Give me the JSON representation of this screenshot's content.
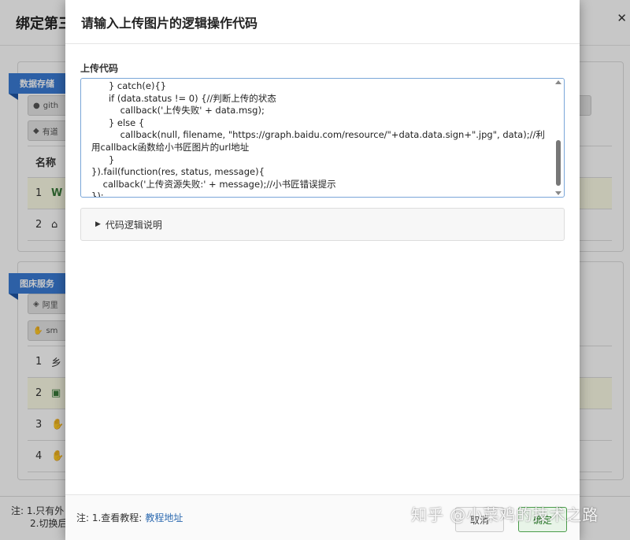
{
  "background": {
    "title": "绑定第三",
    "panel1": {
      "ribbon": "数据存储",
      "buttons": [
        "gith",
        "有道"
      ],
      "table_header": "名称",
      "rows": [
        {
          "num": "1",
          "glyph": "W"
        },
        {
          "num": "2",
          "glyph": "⌂"
        }
      ]
    },
    "panel2": {
      "ribbon": "图床服务",
      "buttons": [
        "阿里",
        "sm"
      ],
      "rows": [
        {
          "num": "1",
          "glyph": "乡"
        },
        {
          "num": "2",
          "glyph": "▣"
        },
        {
          "num": "3",
          "glyph": "✋"
        },
        {
          "num": "4",
          "glyph": "✋"
        }
      ]
    },
    "footer": {
      "line1": "注: 1.只有外",
      "line2": "2.切换后"
    },
    "corner_icon": "close-icon"
  },
  "modal": {
    "title": "请输入上传图片的逻辑操作代码",
    "field_label": "上传代码",
    "code": "      } catch(e){}\n      if (data.status != 0) {//判断上传的状态\n          callback('上传失败' + data.msg);\n      } else {\n          callback(null, filename, \"https://graph.baidu.com/resource/\"+data.data.sign+\".jpg\", data);//利用callback函数给小书匠图片的url地址\n      }\n}).fail(function(res, status, message){\n    callback('上传资源失败:' + message);//小书匠错误提示\n});",
    "details_label": "代码逻辑说明",
    "footer_note": "注: 1.查看教程:",
    "footer_link": "教程地址",
    "cancel_label": "取消",
    "ok_label": "确定"
  },
  "watermark": "知乎 @小菜鸡的技术之路"
}
